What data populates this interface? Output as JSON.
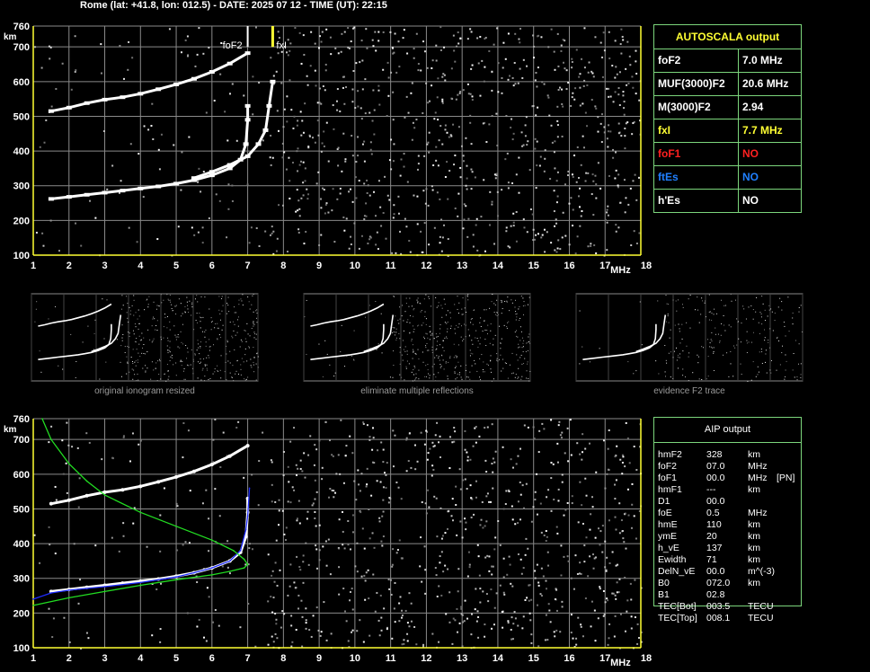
{
  "header": "Rome (lat: +41.8, lon: 012.5) - DATE: 2025 07 12 - TIME (UT): 22:15",
  "colors": {
    "grid": "#8a8a8a",
    "axis": "#ffff33",
    "trace": "#ffffff",
    "fit_blue": "#1e2cff",
    "profile_green": "#22dd22",
    "panel_border": "#7cd67c",
    "red": "#ff2020",
    "blue": "#2080ff"
  },
  "axes": {
    "x_ticks": [
      "1",
      "2",
      "3",
      "4",
      "5",
      "6",
      "7",
      "8",
      "9",
      "10",
      "11",
      "12",
      "13",
      "14",
      "15",
      "16",
      "17",
      "18"
    ],
    "y_ticks": [
      "760",
      "700",
      "600",
      "500",
      "400",
      "300",
      "200",
      "100"
    ],
    "x_unit": "MHz",
    "y_unit": "km"
  },
  "markers": {
    "foF2_label": "foF2",
    "fxI_label": "fxI"
  },
  "autoscala": {
    "title": "AUTOSCALA output",
    "rows": [
      {
        "label": "foF2",
        "value": "7.0 MHz",
        "color": "#ffffff"
      },
      {
        "label": "MUF(3000)F2",
        "value": "20.6 MHz",
        "color": "#ffffff"
      },
      {
        "label": "M(3000)F2",
        "value": "2.94",
        "color": "#ffffff"
      },
      {
        "label": "fxI",
        "value": "7.7 MHz",
        "color": "#ffff33"
      },
      {
        "label": "foF1",
        "value": "NO",
        "color": "#ff2020"
      },
      {
        "label": "ftEs",
        "value": "NO",
        "color": "#2080ff"
      },
      {
        "label": "h'Es",
        "value": "NO",
        "color": "#ffffff"
      }
    ]
  },
  "thumbnails": [
    {
      "caption": "original ionogram resized"
    },
    {
      "caption": "eliminate multiple reflections"
    },
    {
      "caption": "evidence F2 trace"
    }
  ],
  "aip": {
    "title": "AIP output",
    "rows": [
      {
        "label": "hmF2",
        "value": "328",
        "unit": "km",
        "extra": ""
      },
      {
        "label": "foF2",
        "value": "07.0",
        "unit": "MHz",
        "extra": ""
      },
      {
        "label": "foF1",
        "value": "00.0",
        "unit": "MHz",
        "extra": "[PN]"
      },
      {
        "label": "hmF1",
        "value": "---",
        "unit": "km",
        "extra": ""
      },
      {
        "label": "D1",
        "value": "00.0",
        "unit": "",
        "extra": ""
      },
      {
        "label": "foE",
        "value": "0.5",
        "unit": "MHz",
        "extra": ""
      },
      {
        "label": "hmE",
        "value": "110",
        "unit": "km",
        "extra": ""
      },
      {
        "label": "ymE",
        "value": "20",
        "unit": "km",
        "extra": ""
      },
      {
        "label": "h_vE",
        "value": "137",
        "unit": "km",
        "extra": ""
      },
      {
        "label": "Ewidth",
        "value": "71",
        "unit": "km",
        "extra": ""
      },
      {
        "label": "DelN_vE",
        "value": "00.0",
        "unit": "m^(-3)",
        "extra": ""
      },
      {
        "label": "B0",
        "value": "072.0",
        "unit": "km",
        "extra": ""
      },
      {
        "label": "B1",
        "value": "02.8",
        "unit": "",
        "extra": ""
      },
      {
        "label": "TEC[Bot]",
        "value": "003.5",
        "unit": "TECU",
        "extra": ""
      },
      {
        "label": "TEC[Top]",
        "value": "008.1",
        "unit": "TECU",
        "extra": ""
      }
    ]
  },
  "chart_data": [
    {
      "type": "scatter",
      "xlim": [
        1,
        18
      ],
      "ylim": [
        100,
        760
      ],
      "series": [
        {
          "values": [
            [
              1.5,
              515
            ],
            [
              2.0,
              525
            ],
            [
              2.5,
              538
            ],
            [
              3.0,
              548
            ],
            [
              3.5,
              555
            ],
            [
              4.0,
              565
            ],
            [
              4.5,
              578
            ],
            [
              5.0,
              592
            ],
            [
              5.5,
              608
            ],
            [
              6.0,
              628
            ],
            [
              6.5,
              652
            ],
            [
              7.0,
              682
            ]
          ]
        },
        {
          "values": [
            [
              1.5,
              262
            ],
            [
              2.0,
              268
            ],
            [
              2.5,
              274
            ],
            [
              3.0,
              280
            ],
            [
              3.5,
              286
            ],
            [
              4.0,
              292
            ],
            [
              4.5,
              298
            ],
            [
              5.0,
              306
            ],
            [
              5.5,
              316
            ],
            [
              6.0,
              330
            ],
            [
              6.5,
              350
            ],
            [
              6.8,
              375
            ],
            [
              6.95,
              420
            ],
            [
              7.0,
              490
            ],
            [
              7.0,
              530
            ]
          ]
        },
        {
          "values": [
            [
              5.5,
              322
            ],
            [
              6.0,
              340
            ],
            [
              6.5,
              360
            ],
            [
              7.0,
              385
            ],
            [
              7.3,
              420
            ],
            [
              7.5,
              460
            ],
            [
              7.6,
              530
            ],
            [
              7.7,
              600
            ]
          ]
        }
      ]
    },
    {
      "type": "line",
      "xlim": [
        1,
        18
      ],
      "ylim": [
        100,
        760
      ],
      "series": [
        {
          "values": [
            [
              1.5,
              515
            ],
            [
              2.0,
              525
            ],
            [
              2.5,
              538
            ],
            [
              3.0,
              548
            ],
            [
              3.5,
              555
            ],
            [
              4.0,
              565
            ],
            [
              4.5,
              578
            ],
            [
              5.0,
              592
            ],
            [
              5.5,
              608
            ],
            [
              6.0,
              628
            ],
            [
              6.5,
              652
            ],
            [
              7.0,
              682
            ]
          ]
        },
        {
          "values": [
            [
              1.5,
              262
            ],
            [
              2.0,
              268
            ],
            [
              2.5,
              274
            ],
            [
              3.0,
              280
            ],
            [
              3.5,
              286
            ],
            [
              4.0,
              292
            ],
            [
              4.5,
              298
            ],
            [
              5.0,
              306
            ],
            [
              5.5,
              316
            ],
            [
              6.0,
              330
            ],
            [
              6.5,
              350
            ],
            [
              6.8,
              375
            ],
            [
              6.95,
              420
            ],
            [
              7.0,
              490
            ],
            [
              7.0,
              530
            ]
          ]
        },
        {
          "values": [
            [
              1.0,
              240
            ],
            [
              1.5,
              258
            ],
            [
              2.0,
              266
            ],
            [
              3.0,
              276
            ],
            [
              4.0,
              288
            ],
            [
              5.0,
              304
            ],
            [
              5.5,
              316
            ],
            [
              6.0,
              330
            ],
            [
              6.5,
              350
            ],
            [
              6.8,
              380
            ],
            [
              6.95,
              440
            ],
            [
              7.0,
              480
            ],
            [
              7.05,
              560
            ]
          ]
        },
        {
          "values": [
            [
              1.25,
              760
            ],
            [
              1.5,
              700
            ],
            [
              2.0,
              630
            ],
            [
              2.5,
              580
            ],
            [
              3.0,
              540
            ],
            [
              4.0,
              490
            ],
            [
              5.0,
              450
            ],
            [
              6.0,
              410
            ],
            [
              6.6,
              380
            ],
            [
              6.9,
              355
            ],
            [
              7.0,
              340
            ],
            [
              6.9,
              330
            ],
            [
              6.5,
              320
            ],
            [
              6.0,
              310
            ],
            [
              5.0,
              296
            ],
            [
              4.0,
              280
            ],
            [
              3.0,
              262
            ],
            [
              2.0,
              244
            ],
            [
              1.0,
              222
            ]
          ]
        }
      ]
    }
  ]
}
